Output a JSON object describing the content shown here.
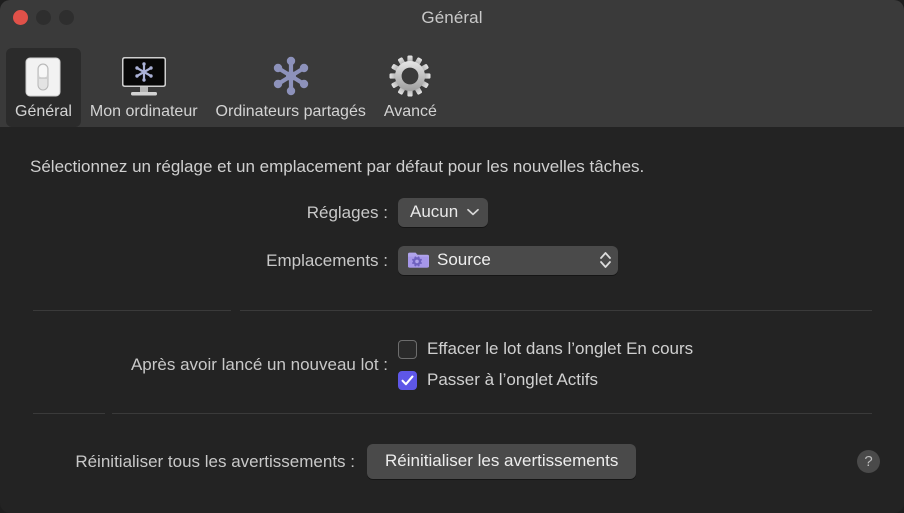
{
  "window": {
    "title": "Général",
    "traffic_lights": [
      {
        "name": "close",
        "color": "#e05149"
      },
      {
        "name": "minimize",
        "color": "#2e2e2e"
      },
      {
        "name": "zoom",
        "color": "#2e2e2e"
      }
    ]
  },
  "toolbar": {
    "items": [
      {
        "label": "Général",
        "icon": "light-switch-icon",
        "selected": true
      },
      {
        "label": "Mon ordinateur",
        "icon": "display-snowflake-icon",
        "selected": false
      },
      {
        "label": "Ordinateurs partagés",
        "icon": "network-star-icon",
        "selected": false
      },
      {
        "label": "Avancé",
        "icon": "gear-icon",
        "selected": false
      }
    ]
  },
  "content": {
    "intro": "Sélectionnez un réglage et un emplacement par défaut pour les nouvelles tâches.",
    "settings_row": {
      "label": "Réglages :",
      "value": "Aucun",
      "indicator": "chevron-down-icon"
    },
    "locations_row": {
      "label": "Emplacements :",
      "value": "Source",
      "icon": "purple-folder-gear-icon",
      "indicator": "chevron-up-down-icon"
    },
    "after_batch_row": {
      "label": "Après avoir lancé un nouveau lot :",
      "options": [
        {
          "label": "Effacer le lot dans l’onglet En cours",
          "checked": false
        },
        {
          "label": "Passer à l’onglet Actifs",
          "checked": true
        }
      ]
    },
    "reset_row": {
      "label": "Réinitialiser tous les avertissements :",
      "button": "Réinitialiser les avertissements"
    },
    "help_button": "?"
  },
  "colors": {
    "accent": "#5e57e8",
    "titlebar": "#3a3a3a",
    "content_bg": "#232323",
    "control_bg": "#4a4a4a",
    "folder_purple": "#b0a4ec",
    "network_icon": "#8d92bb",
    "close_red": "#e05149"
  }
}
